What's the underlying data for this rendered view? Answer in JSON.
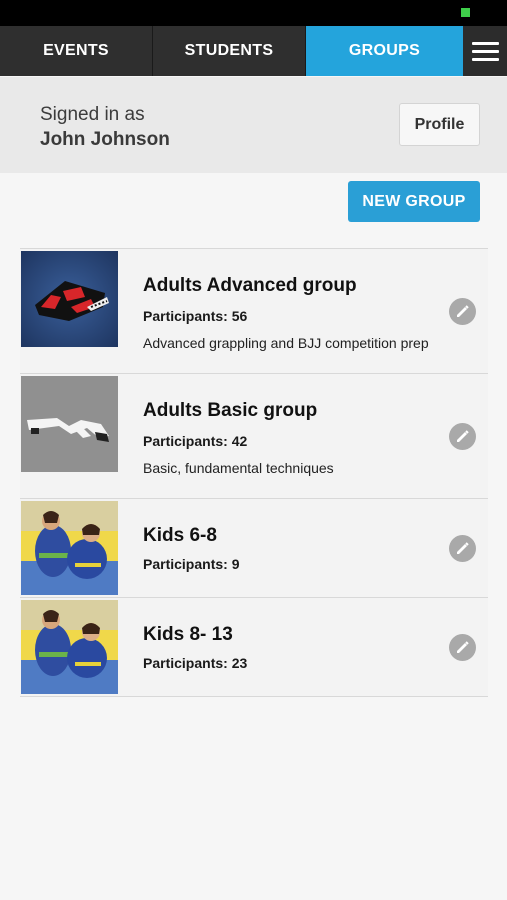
{
  "tabs": [
    {
      "label": "EVENTS"
    },
    {
      "label": "STUDENTS"
    },
    {
      "label": "GROUPS"
    }
  ],
  "colors": {
    "accent": "#24a4dc",
    "nav_bg": "#2c2c2c",
    "status_dot": "#3ecf4a"
  },
  "signin": {
    "label": "Signed in as",
    "name": "John Johnson",
    "profile_label": "Profile"
  },
  "new_group_label": "NEW GROUP",
  "groups": [
    {
      "title": "Adults Advanced group",
      "participants": "Participants: 56",
      "description": "Advanced grappling and BJJ competition prep"
    },
    {
      "title": "Adults Basic group",
      "participants": "Participants: 42",
      "description": "Basic, fundamental techniques"
    },
    {
      "title": "Kids 6-8",
      "participants": "Participants: 9"
    },
    {
      "title": "Kids 8- 13",
      "participants": "Participants: 23"
    }
  ]
}
